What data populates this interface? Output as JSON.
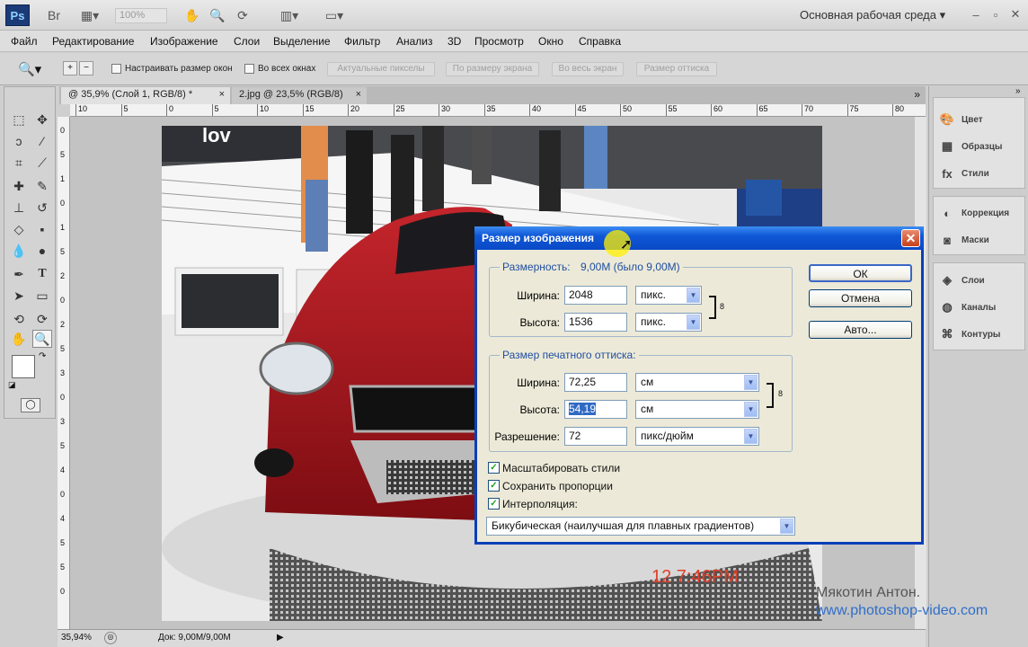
{
  "app": {
    "logo": "Ps",
    "zoom_value": "100%",
    "workspace": "Основная рабочая среда",
    "icons": [
      "bridge-icon",
      "layout-icon",
      "hand-icon",
      "zoom-icon",
      "rotate-icon",
      "arrange-icon",
      "screen-mode-icon"
    ]
  },
  "menu": [
    "Файл",
    "Редактирование",
    "Изображение",
    "Слои",
    "Выделение",
    "Фильтр",
    "Анализ",
    "3D",
    "Просмотр",
    "Окно",
    "Справка"
  ],
  "options": {
    "resize_windows": "Настраивать размер окон",
    "all_windows": "Во всех окнах",
    "actual_pixels": "Актуальные пикселы",
    "fit_screen": "По размеру экрана",
    "fill_screen": "Во весь экран",
    "print_size": "Размер оттиска"
  },
  "tabs": [
    {
      "label": "@ 35,9% (Слой 1, RGB/8) *",
      "close": "×"
    },
    {
      "label": "2.jpg @ 23,5% (RGB/8)",
      "close": "×"
    }
  ],
  "ruler_top": [
    "10",
    "5",
    "0",
    "5",
    "10",
    "15",
    "20",
    "25",
    "30",
    "35",
    "40",
    "45",
    "50",
    "55",
    "60",
    "65",
    "70",
    "75",
    "80"
  ],
  "ruler_left": [
    "0",
    "5",
    "1",
    "0",
    "1",
    "5",
    "2",
    "0",
    "2",
    "5",
    "3",
    "0",
    "3",
    "5",
    "4",
    "0",
    "4",
    "5",
    "5",
    "0"
  ],
  "photo": {
    "timestamp": "12  7:46PM",
    "banner_text": "lov"
  },
  "status": {
    "zoom": "35,94%",
    "doc": "Док: 9,00M/9,00M"
  },
  "panels": [
    {
      "label": "Цвет",
      "icon": "color-icon"
    },
    {
      "label": "Образцы",
      "icon": "swatches-icon"
    },
    {
      "label": "Стили",
      "icon": "styles-icon"
    },
    {
      "label": "Коррекция",
      "icon": "adjustments-icon"
    },
    {
      "label": "Маски",
      "icon": "masks-icon"
    },
    {
      "label": "Слои",
      "icon": "layers-icon"
    },
    {
      "label": "Каналы",
      "icon": "channels-icon"
    },
    {
      "label": "Контуры",
      "icon": "paths-icon"
    }
  ],
  "dialog": {
    "title": "Размер изображения",
    "pixel_dims_label": "Размерность:",
    "pixel_dims_value": "9,00M (было 9,00M)",
    "width_label": "Ширина:",
    "height_label": "Высота:",
    "px_width": "2048",
    "px_height": "1536",
    "px_unit": "пикс.",
    "print_legend": "Размер печатного оттиска:",
    "doc_width": "72,25",
    "doc_height": "54,19",
    "doc_unit": "см",
    "resolution_label": "Разрешение:",
    "resolution": "72",
    "resolution_unit": "пикс/дюйм",
    "ok": "ОК",
    "cancel": "Отмена",
    "auto": "Авто...",
    "scale_styles": "Масштабировать стили",
    "constrain": "Сохранить пропорции",
    "resample": "Интерполяция:",
    "resample_method": "Бикубическая (наилучшая для плавных градиентов)",
    "check": "✓"
  },
  "watermark": {
    "line1": "Мякотин Антон.",
    "line2": "www.photoshop-video.com"
  }
}
